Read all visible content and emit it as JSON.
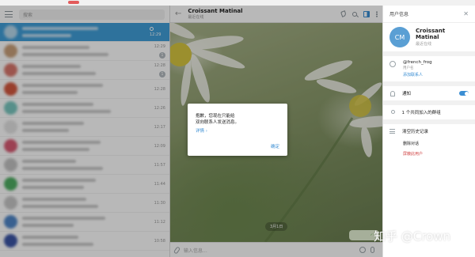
{
  "search": {
    "placeholder": "搜索"
  },
  "chat_list": [
    {
      "time": "12:29",
      "badge": "",
      "active": true,
      "avatar_color": "#b7d8ec"
    },
    {
      "time": "12:29",
      "badge": "1",
      "active": false,
      "avatar_color": "#c9a07a"
    },
    {
      "time": "12:28",
      "badge": "1",
      "active": false,
      "avatar_color": "#d9776c"
    },
    {
      "time": "12:28",
      "badge": "",
      "active": false,
      "avatar_color": "#d4583f"
    },
    {
      "time": "12:26",
      "badge": "",
      "active": false,
      "avatar_color": "#79c7bf"
    },
    {
      "time": "12:17",
      "badge": "",
      "active": false,
      "avatar_color": "#e2e2e2"
    },
    {
      "time": "12:09",
      "badge": "",
      "active": false,
      "avatar_color": "#d85b73"
    },
    {
      "time": "11:57",
      "badge": "",
      "active": false,
      "avatar_color": "#c3c3c3"
    },
    {
      "time": "11:44",
      "badge": "",
      "active": false,
      "avatar_color": "#4fae63"
    },
    {
      "time": "11:30",
      "badge": "",
      "active": false,
      "avatar_color": "#c7c7c7"
    },
    {
      "time": "11:12",
      "badge": "",
      "active": false,
      "avatar_color": "#4f86c8"
    },
    {
      "time": "10:58",
      "badge": "",
      "active": false,
      "avatar_color": "#3b55a6"
    }
  ],
  "chat": {
    "name": "Croissant Matinal",
    "status": "最近在线",
    "date_pill": "3月1日",
    "composer_placeholder": "输入信息..."
  },
  "dialog": {
    "line1": "抱歉，您现在只能给",
    "line2": "双向联系人发送消息。",
    "more": "详情 ›",
    "ok": "确定"
  },
  "info_panel": {
    "title": "用户信息",
    "avatar_initials": "CM",
    "name": "Croissant Matinal",
    "status": "最近在线",
    "username": "@french_frog",
    "username_label": "用户名",
    "add_contact": "添加联系人",
    "notifications": "通知",
    "groups_in_common": "1 个共同加入的群组",
    "clear_history": "清空历史记录",
    "delete_chat": "删除对话",
    "block_user": "屏蔽此用户"
  },
  "watermark": "知乎 @Crown"
}
